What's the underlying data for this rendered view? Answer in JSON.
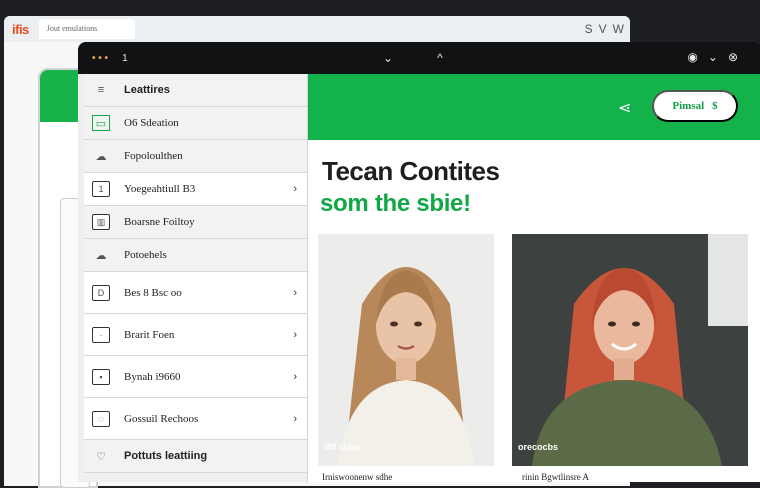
{
  "back_browser": {
    "logo": "ifis",
    "tab_title": "Jout emulations",
    "icons": [
      "S",
      "V",
      "W"
    ]
  },
  "front_topbar": {
    "left_label": "1",
    "center_icons": [
      "chevron-down-icon",
      "chevron-up-icon"
    ],
    "right_icons": [
      "record-icon",
      "chevron-down-icon",
      "close-icon"
    ]
  },
  "sidebar": {
    "items": [
      {
        "label": "Leattires",
        "icon": "≡"
      },
      {
        "label": "O6 Sdeation",
        "icon": "▭"
      },
      {
        "label": "Fopoloulthen",
        "icon": "☁"
      },
      {
        "label": "Yoegeahtiull B3",
        "icon": "1"
      },
      {
        "label": "Boarsne Foiltoy",
        "icon": "▥"
      },
      {
        "label": "Potoehels",
        "icon": "☁"
      },
      {
        "label": "Bes 8 Bsc oo",
        "icon": "D"
      },
      {
        "label": "Brarit Foen",
        "icon": "·"
      },
      {
        "label": "Bynah i9660",
        "icon": "▪"
      },
      {
        "label": "Gossuil Rechoos",
        "icon": "◌"
      },
      {
        "label": "Pottuts leattiing",
        "icon": "♡"
      }
    ]
  },
  "hero": {
    "cta_label": "Pimsal",
    "cta_suffix": "$"
  },
  "content": {
    "title": "Tecan Contites",
    "subtitle": "som the sbie!",
    "cards": [
      {
        "caption": "i99 cUse",
        "sub": "Irniswoonenw sdhe"
      },
      {
        "caption": "orecocbs",
        "sub": "rinin Bgwtlinsre A"
      }
    ]
  },
  "colors": {
    "accent_green": "#13b24a",
    "window_dark": "#111214",
    "sidebar_bg": "#efefef"
  }
}
